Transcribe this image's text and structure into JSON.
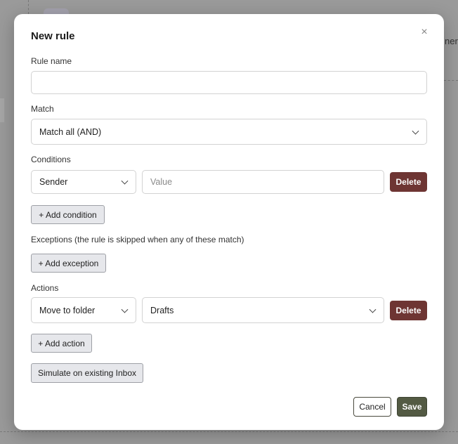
{
  "background": {
    "partial_text": "ner"
  },
  "dialog": {
    "title": "New rule",
    "close_glyph": "×",
    "rule_name": {
      "label": "Rule name",
      "value": ""
    },
    "match": {
      "label": "Match",
      "selected": "Match all (AND)"
    },
    "conditions": {
      "label": "Conditions",
      "rows": [
        {
          "field": "Sender",
          "value_placeholder": "Value",
          "delete_label": "Delete"
        }
      ],
      "add_label": "+ Add condition"
    },
    "exceptions": {
      "label": "Exceptions (the rule is skipped when any of these match)",
      "add_label": "+ Add exception"
    },
    "actions": {
      "label": "Actions",
      "rows": [
        {
          "action": "Move to folder",
          "target": "Drafts",
          "delete_label": "Delete"
        }
      ],
      "add_label": "+ Add action"
    },
    "simulate_label": "Simulate on existing Inbox",
    "cancel_label": "Cancel",
    "save_label": "Save"
  },
  "colors": {
    "delete_button": "#6e3533",
    "save_button": "#535a43",
    "backdrop": "#8e8e8e"
  },
  "icons": {
    "close": "close-icon",
    "dropdown": "chevron-down-icon"
  }
}
